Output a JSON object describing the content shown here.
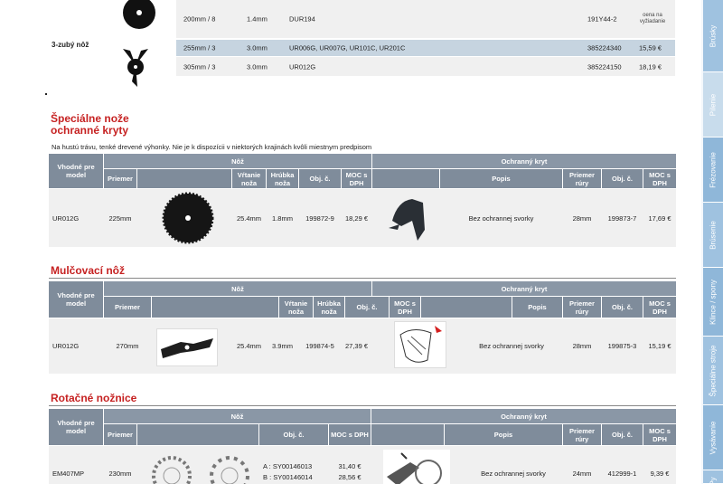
{
  "top_rows": [
    {
      "size": "200mm / 8",
      "thickness": "1.4mm",
      "models": "DUR194",
      "code": "191Y44-2",
      "price": "oena na vyžiadanie"
    },
    {
      "size": "255mm / 3",
      "thickness": "3.0mm",
      "models": "UR006G, UR007G, UR101C, UR201C",
      "code": "385224340",
      "price": "15,59 €"
    },
    {
      "size": "305mm / 3",
      "thickness": "3.0mm",
      "models": "UR012G",
      "code": "385224150",
      "price": "18,19 €"
    }
  ],
  "label_3": "3-zubý nôž",
  "section1": {
    "title_line1": "Špeciálne nože",
    "title_line2": "ochranné kryty",
    "desc": "Na hustú trávu, tenké drevené výhonky. Nie je k dispozícii v niektorých krajinách kvôli miestnym predpisom"
  },
  "section2": {
    "title": "Mulčovací nôž"
  },
  "section3": {
    "title": "Rotačné nožnice"
  },
  "headers": {
    "suitable": "Vhodné pre model",
    "knife": "Nôž",
    "guard": "Ochranný kryt",
    "diameter": "Priemer",
    "bore": "Vŕtanie noža",
    "thickness": "Hrúbka noža",
    "code": "Obj. č.",
    "price": "MOC s DPH",
    "description": "Popis",
    "tube": "Priemer rúry"
  },
  "rows": {
    "r1": {
      "model": "UR012G",
      "diameter": "225mm",
      "bore": "25.4mm",
      "thickness": "1.8mm",
      "code": "199872-9",
      "price": "18,29 €",
      "desc": "Bez ochrannej svorky",
      "tube": "28mm",
      "g_code": "199873-7",
      "g_price": "17,69 €"
    },
    "r2": {
      "model": "UR012G",
      "diameter": "270mm",
      "bore": "25.4mm",
      "thickness": "3.9mm",
      "code": "199874-5",
      "price": "27,39 €",
      "desc": "Bez ochrannej svorky",
      "tube": "28mm",
      "g_code": "199875-3",
      "g_price": "15,19 €"
    },
    "r3": {
      "model": "EM407MP",
      "diameter": "230mm",
      "code_a": "A : SY00146013",
      "code_b": "B : SY00146014",
      "price_a": "31,40 €",
      "price_b": "28,56 €",
      "desc": "Bez ochrannej svorky",
      "tube": "24mm",
      "g_code": "412999-1",
      "g_price": "9,39 €"
    }
  },
  "side_tabs": [
    "Brúsky",
    "Pílenie",
    "Frézovanie",
    "Brúsenie",
    "Klince / spony",
    "Špeciálne stroje",
    "Vysávanie",
    "Py"
  ]
}
